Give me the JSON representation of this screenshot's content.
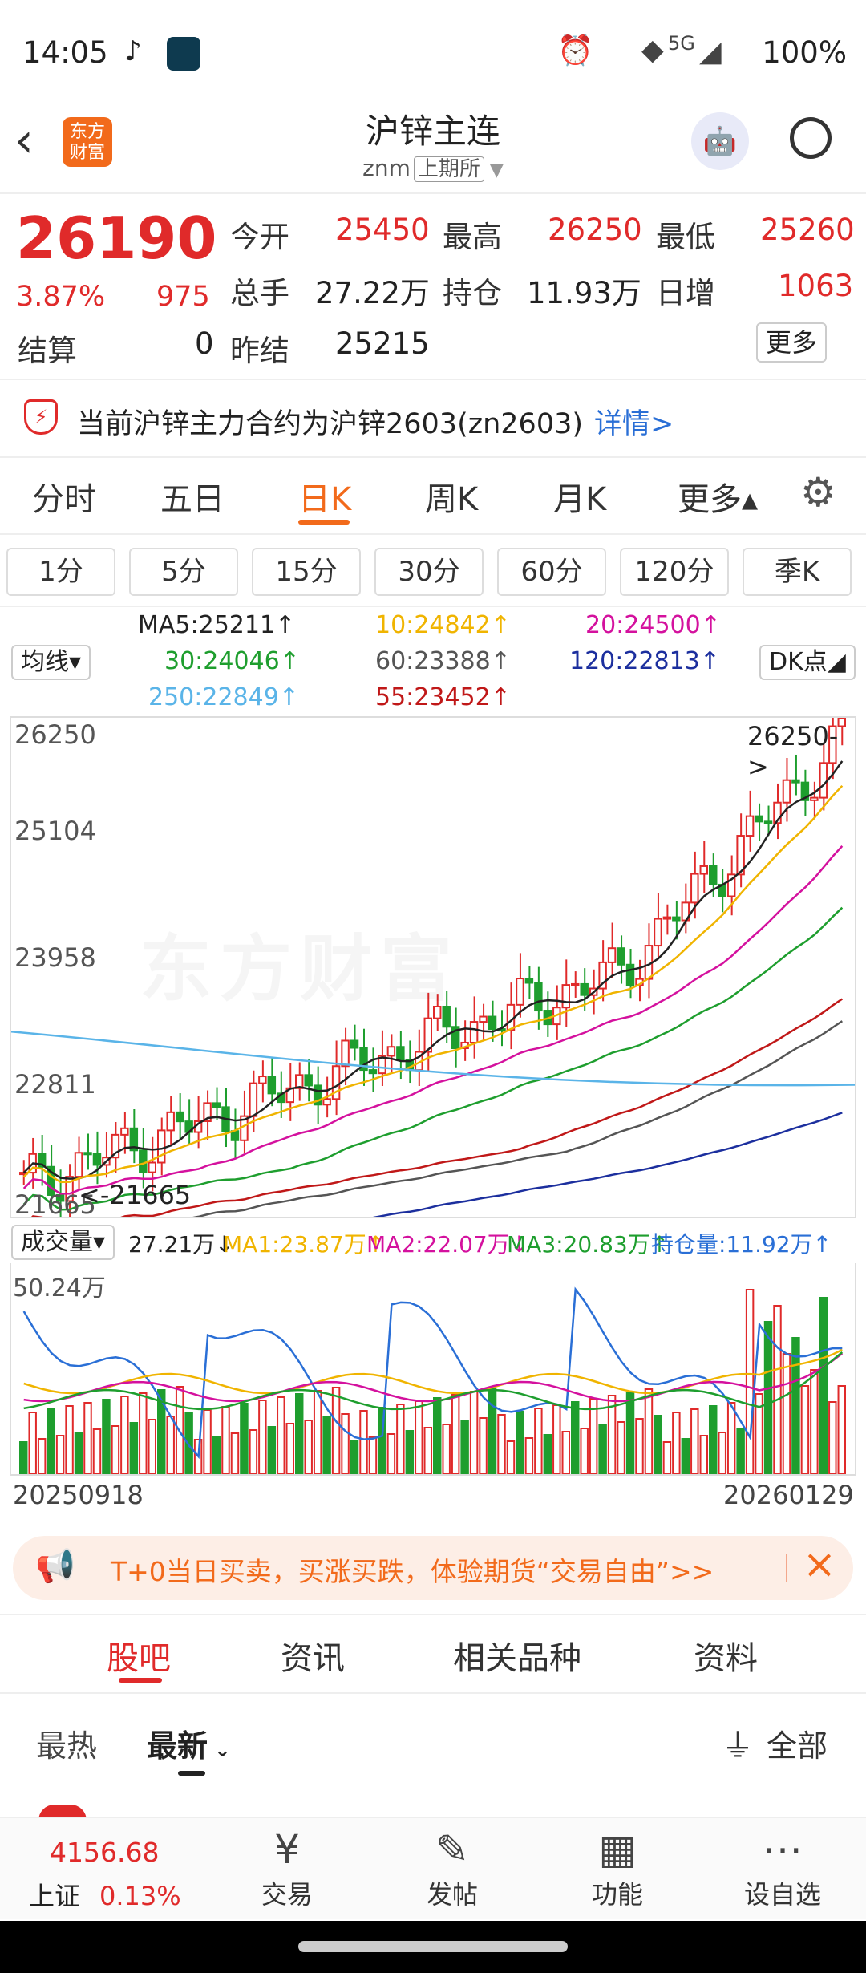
{
  "status": {
    "time": "14:05",
    "battery": "100%",
    "signal": "5G"
  },
  "header": {
    "title": "沪锌主连",
    "code": "znm",
    "exchange": "上期所",
    "logo": "东方\n财富"
  },
  "quote": {
    "price": "26190",
    "change_pct": "3.87%",
    "change": "975",
    "open_label": "今开",
    "open": "25450",
    "high_label": "最高",
    "high": "26250",
    "low_label": "最低",
    "low": "25260",
    "vol_label": "总手",
    "vol": "27.22万",
    "oi_label": "持仓",
    "oi": "11.93万",
    "inc_label": "日增",
    "inc": "1063",
    "settle_label": "结算",
    "settle": "0",
    "prev_label": "昨结",
    "prev": "25215",
    "more": "更多"
  },
  "notice": {
    "text": "当前沪锌主力合约为沪锌2603(zn2603)",
    "link": "详情>"
  },
  "tabs": [
    "分时",
    "五日",
    "日K",
    "周K",
    "月K",
    "更多▴"
  ],
  "periods": [
    "1分",
    "5分",
    "15分",
    "30分",
    "60分",
    "120分",
    "季K"
  ],
  "ma": {
    "selector": "均线▾",
    "ma5": "MA5:25211↑",
    "ma10": "10:24842↑",
    "ma20": "20:24500↑",
    "ma30": "30:24046↑",
    "ma60": "60:23388↑",
    "ma120": "120:22813↑",
    "ma250": "250:22849↑",
    "ma55": "55:23452↑",
    "dk": "DK点◢"
  },
  "axis": {
    "y1": "26250",
    "y2": "25104",
    "y3": "23958",
    "y4": "22811",
    "y5": "21665",
    "max_label": "26250->",
    "min_label": "<-21665"
  },
  "volbar": {
    "selector": "成交量▾",
    "vol": "27.21万↓",
    "ma1": "MA1:23.87万↑",
    "ma2": "MA2:22.07万↓",
    "ma3": "MA3:20.83万↑",
    "oi": "持仓量:11.92万↑",
    "top": "50.24万"
  },
  "dates": {
    "start": "20250918",
    "end": "20260129"
  },
  "colors": {
    "up": "#e02a2a",
    "down": "#1e9e2e",
    "accent": "#f26a1b"
  },
  "banner": {
    "text": "T+0当日买卖，买涨买跌，体验期货“交易自由”>>"
  },
  "bottom_tabs": [
    "股吧",
    "资讯",
    "相关品种",
    "资料"
  ],
  "feed": {
    "hot": "最热",
    "latest": "最新",
    "filter": "全部"
  },
  "nav": {
    "index_value": "4156.68",
    "index_name": "上证",
    "index_change": "0.13%",
    "trade": "交易",
    "post": "发帖",
    "func": "功能",
    "watch": "设自选"
  }
}
